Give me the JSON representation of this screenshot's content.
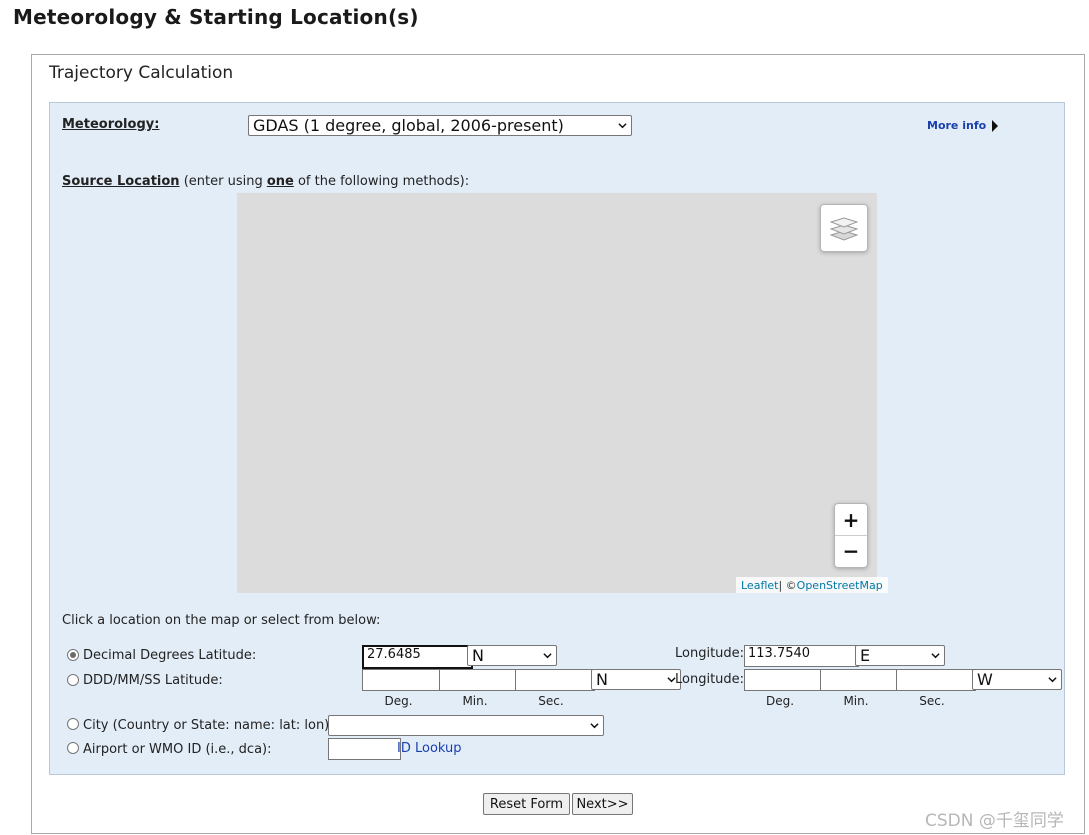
{
  "page": {
    "title": "Meteorology & Starting Location(s)"
  },
  "panel": {
    "title": "Trajectory Calculation"
  },
  "meteorology": {
    "label": "Meteorology:",
    "selected": "GDAS (1 degree, global, 2006-present)",
    "more_info": "More info"
  },
  "source": {
    "label": "Source Location",
    "hint_pre": " (enter using ",
    "hint_bold": "one",
    "hint_post": " of the following methods):"
  },
  "map": {
    "attribution_leaflet": "Leaflet",
    "attribution_sep": " | © ",
    "attribution_osm": "OpenStreetMap",
    "zoom_in": "+",
    "zoom_out": "−"
  },
  "click_text": "Click a location on the map or select from below:",
  "decimal": {
    "label": "Decimal Degrees Latitude:",
    "lat_value": "27.6485",
    "lat_dir": "N",
    "lon_label": "Longitude:",
    "lon_value": "113.7540",
    "lon_dir": "E"
  },
  "dms": {
    "label": "DDD/MM/SS Latitude:",
    "lat_dir": "N",
    "lon_label": "Longitude:",
    "lon_dir": "W",
    "deg": "Deg.",
    "min": "Min.",
    "sec": "Sec."
  },
  "city": {
    "label": "City (Country or State: name: lat: lon):",
    "selected": ""
  },
  "airport": {
    "label": "Airport or WMO ID (i.e., dca):",
    "value": "",
    "lookup": "ID Lookup"
  },
  "buttons": {
    "reset": "Reset Form",
    "next": "Next>>"
  },
  "watermark": "CSDN @千玺同学"
}
